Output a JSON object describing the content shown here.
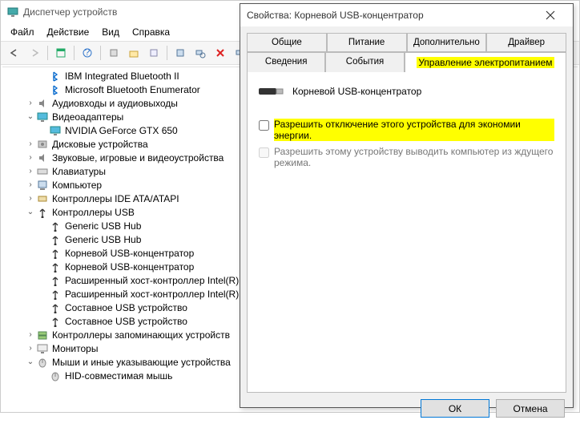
{
  "dm": {
    "title": "Диспетчер устройств",
    "menu": [
      "Файл",
      "Действие",
      "Вид",
      "Справка"
    ],
    "toolbar": [
      "back",
      "forward",
      "sep",
      "props",
      "sep",
      "help",
      "sep",
      "scan",
      "update",
      "remove",
      "sep",
      "disable",
      "search",
      "info"
    ],
    "tree": [
      {
        "lvl": 1,
        "exp": "",
        "icon": "bt",
        "label": "IBM Integrated Bluetooth II"
      },
      {
        "lvl": 1,
        "exp": "",
        "icon": "bt",
        "label": "Microsoft Bluetooth Enumerator"
      },
      {
        "lvl": 0,
        "exp": ">",
        "icon": "audio",
        "label": "Аудиовходы и аудиовыходы"
      },
      {
        "lvl": 0,
        "exp": "v",
        "icon": "display",
        "label": "Видеоадаптеры"
      },
      {
        "lvl": 1,
        "exp": "",
        "icon": "display",
        "label": "NVIDIA GeForce GTX 650"
      },
      {
        "lvl": 0,
        "exp": ">",
        "icon": "disk",
        "label": "Дисковые устройства"
      },
      {
        "lvl": 0,
        "exp": ">",
        "icon": "audio",
        "label": "Звуковые, игровые и видеоустройства"
      },
      {
        "lvl": 0,
        "exp": ">",
        "icon": "kb",
        "label": "Клавиатуры"
      },
      {
        "lvl": 0,
        "exp": ">",
        "icon": "pc",
        "label": "Компьютер"
      },
      {
        "lvl": 0,
        "exp": ">",
        "icon": "ide",
        "label": "Контроллеры IDE ATA/ATAPI"
      },
      {
        "lvl": 0,
        "exp": "v",
        "icon": "usb",
        "label": "Контроллеры USB"
      },
      {
        "lvl": 1,
        "exp": "",
        "icon": "usb",
        "label": "Generic USB Hub"
      },
      {
        "lvl": 1,
        "exp": "",
        "icon": "usb",
        "label": "Generic USB Hub"
      },
      {
        "lvl": 1,
        "exp": "",
        "icon": "usb",
        "label": "Корневой USB-концентратор"
      },
      {
        "lvl": 1,
        "exp": "",
        "icon": "usb",
        "label": "Корневой USB-концентратор"
      },
      {
        "lvl": 1,
        "exp": "",
        "icon": "usb",
        "label": "Расширенный хост-контроллер Intel(R)…"
      },
      {
        "lvl": 1,
        "exp": "",
        "icon": "usb",
        "label": "Расширенный хост-контроллер Intel(R)…"
      },
      {
        "lvl": 1,
        "exp": "",
        "icon": "usb",
        "label": "Составное USB устройство"
      },
      {
        "lvl": 1,
        "exp": "",
        "icon": "usb",
        "label": "Составное USB устройство"
      },
      {
        "lvl": 0,
        "exp": ">",
        "icon": "storage",
        "label": "Контроллеры запоминающих устройств"
      },
      {
        "lvl": 0,
        "exp": ">",
        "icon": "monitor",
        "label": "Мониторы"
      },
      {
        "lvl": 0,
        "exp": "v",
        "icon": "mouse",
        "label": "Мыши и иные указывающие устройства"
      },
      {
        "lvl": 1,
        "exp": "",
        "icon": "mouse",
        "label": "HID-совместимая мышь"
      }
    ]
  },
  "dlg": {
    "title": "Свойства: Корневой USB-концентратор",
    "tabs_row1": [
      "Общие",
      "Питание",
      "Дополнительно",
      "Драйвер"
    ],
    "tabs_row2": [
      "Сведения",
      "События",
      "Управление электропитанием"
    ],
    "device_name": "Корневой USB-концентратор",
    "opt1": "Разрешить отключение этого устройства для экономии энергии.",
    "opt2": "Разрешить этому устройству выводить компьютер из ждущего режима.",
    "ok": "ОК",
    "cancel": "Отмена"
  }
}
